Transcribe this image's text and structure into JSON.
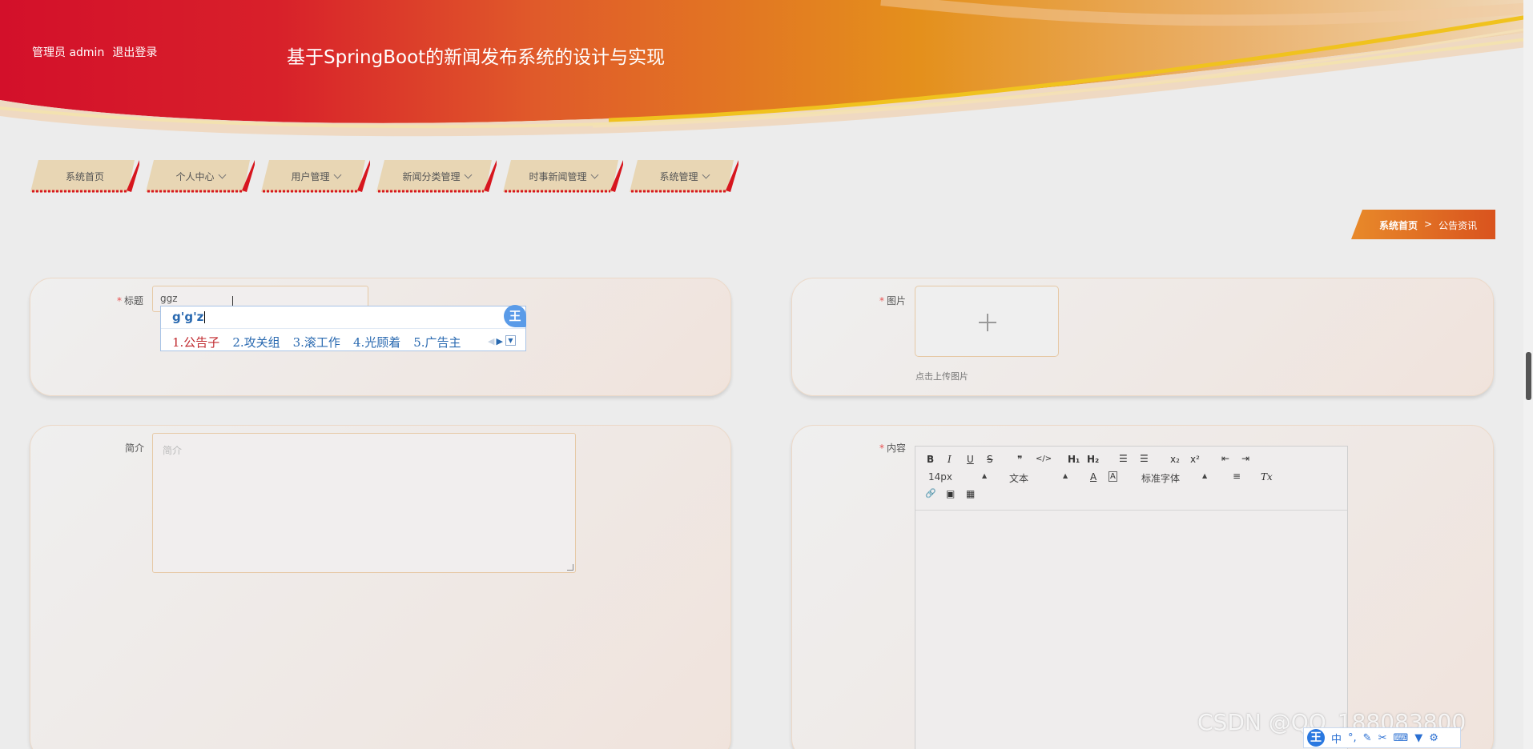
{
  "header": {
    "user_role": "管理员 admin",
    "logout": "退出登录",
    "title": "基于SpringBoot的新闻发布系统的设计与实现"
  },
  "nav": [
    {
      "label": "系统首页",
      "has_dropdown": false
    },
    {
      "label": "个人中心",
      "has_dropdown": true
    },
    {
      "label": "用户管理",
      "has_dropdown": true
    },
    {
      "label": "新闻分类管理",
      "has_dropdown": true
    },
    {
      "label": "时事新闻管理",
      "has_dropdown": true
    },
    {
      "label": "系统管理",
      "has_dropdown": true
    }
  ],
  "breadcrumb": {
    "home": "系统首页",
    "sep": ">",
    "current": "公告资讯"
  },
  "form": {
    "title_label": "标题",
    "title_value": "ggz",
    "image_label": "图片",
    "upload_tip": "点击上传图片",
    "intro_label": "简介",
    "intro_placeholder": "简介",
    "content_label": "内容"
  },
  "ime": {
    "pinyin": "g'g'z",
    "badge": "王",
    "candidates": [
      "1.公告子",
      "2.攻关组",
      "3.滚工作",
      "4.光顾着",
      "5.广告主"
    ]
  },
  "editor": {
    "font_size": "14px",
    "block_type": "文本",
    "font_family": "标准字体",
    "buttons": {
      "bold": "B",
      "italic": "I",
      "underline": "U",
      "strike": "S",
      "quote": "❞",
      "code": "</>",
      "h1": "H₁",
      "h2": "H₂",
      "ordered_list": "☰",
      "bullet_list": "☰",
      "subscript": "x₂",
      "superscript": "x²",
      "indent_left": "⇤",
      "indent_right": "⇥",
      "color": "A",
      "background": "A",
      "align": "≡",
      "clean": "Tx",
      "link": "🔗",
      "image": "▣",
      "video": "▦"
    }
  },
  "watermark": "CSDN @QQ_188083800",
  "ime_bar": {
    "logo": "王",
    "mode": "中"
  },
  "colors": {
    "accent": "#d4141e",
    "nav_bg": "#e8d6b4",
    "breadcrumb": "#e0742a"
  }
}
